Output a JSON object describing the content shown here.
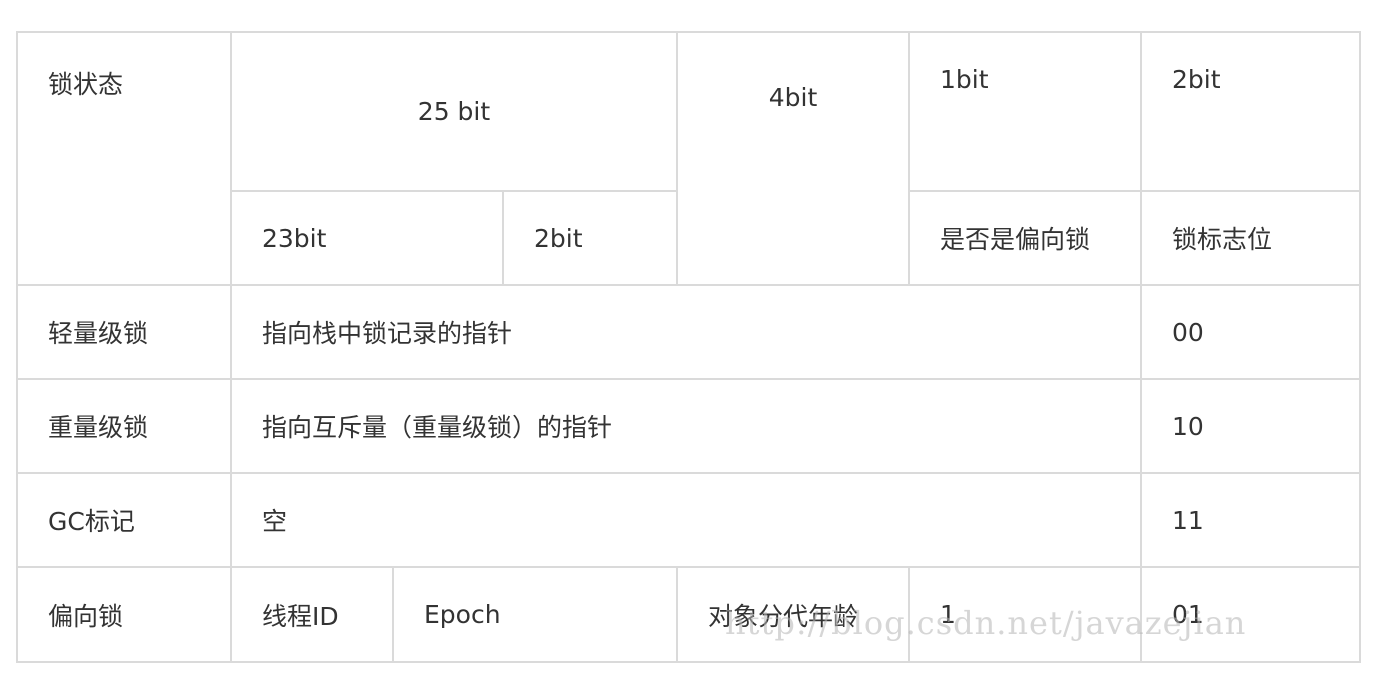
{
  "header": {
    "lock_state": "锁状态",
    "bits_25": "25 bit",
    "bits_4": "4bit",
    "bits_1": "1bit",
    "bits_2": "2bit",
    "bits_23": "23bit",
    "bits_2_sub": "2bit",
    "is_biased": "是否是偏向锁",
    "lock_flag": "锁标志位"
  },
  "rows": [
    {
      "state": "轻量级锁",
      "content": "指向栈中锁记录的指针",
      "flag": "00"
    },
    {
      "state": "重量级锁",
      "content": "指向互斥量（重量级锁）的指针",
      "flag": "10"
    },
    {
      "state": "GC标记",
      "content": "空",
      "flag": "11"
    }
  ],
  "biased": {
    "state": "偏向锁",
    "thread_id": "线程ID",
    "epoch": "Epoch",
    "age": "对象分代年龄",
    "biased_bit": "1",
    "flag": "01"
  },
  "watermark": "http://blog.csdn.net/javazejian"
}
